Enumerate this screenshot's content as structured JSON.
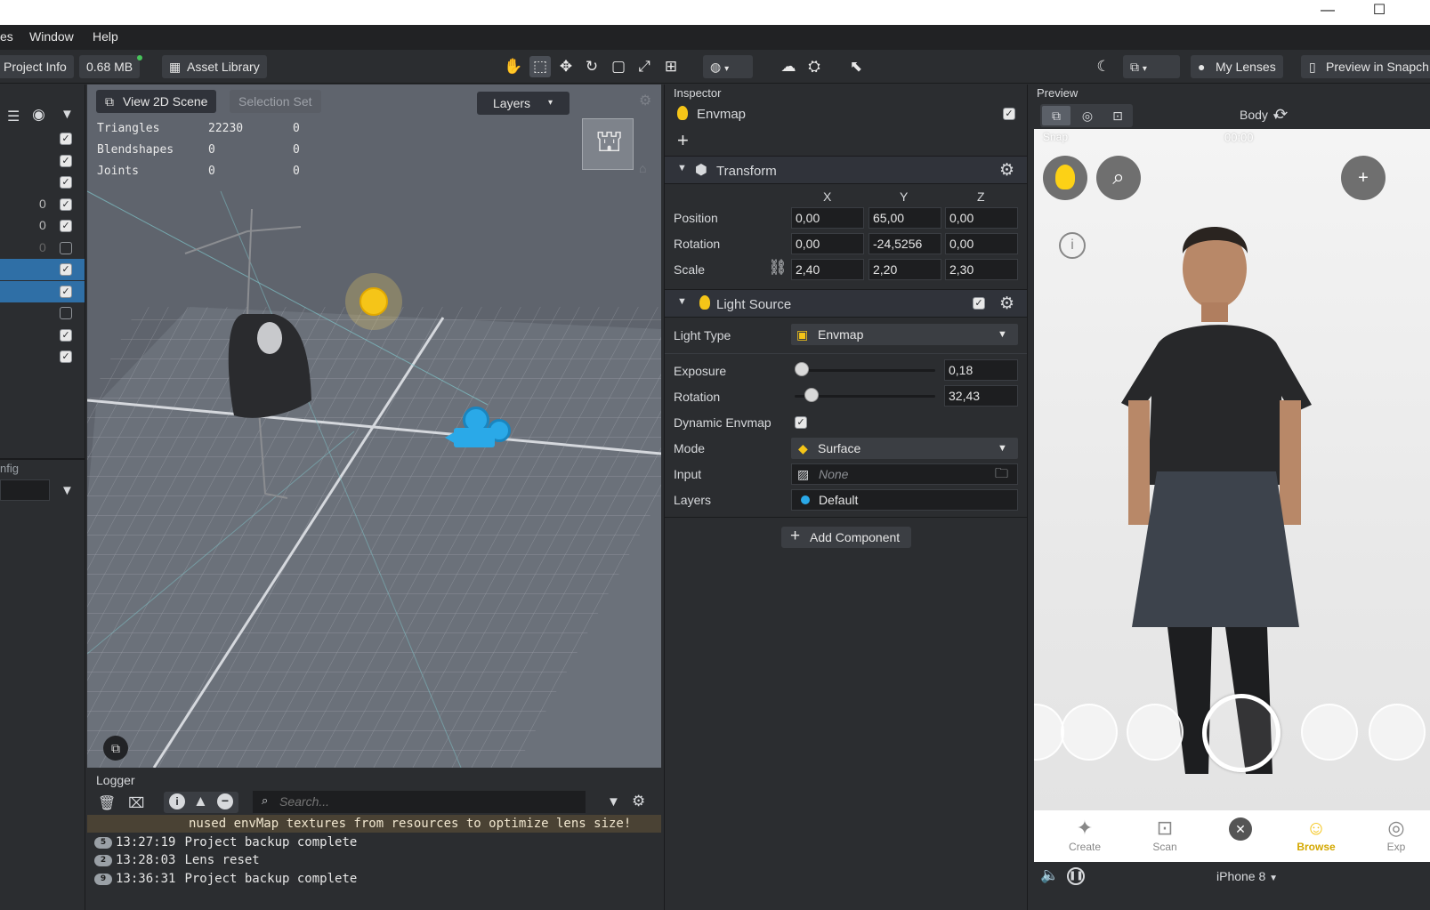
{
  "window": {
    "minimize": "—",
    "maximize": "☐"
  },
  "menu": {
    "items": [
      "es",
      "Window",
      "Help"
    ]
  },
  "toolbar": {
    "project_info": "Project Info",
    "project_size": "0.68 MB",
    "asset_library": "Asset Library",
    "my_lenses": "My Lenses",
    "preview_in_snapchat": "Preview in Snapch"
  },
  "hierarchy": {
    "rows": [
      {
        "num": "",
        "checked": true
      },
      {
        "num": "",
        "checked": true
      },
      {
        "num": "",
        "checked": true
      },
      {
        "num": "0",
        "checked": true
      },
      {
        "num": "0",
        "checked": true
      },
      {
        "num": "0",
        "checked": false
      },
      {
        "num": "",
        "checked": true,
        "selected": true
      },
      {
        "num": "",
        "checked": true,
        "selected": true
      },
      {
        "num": "",
        "checked": false
      },
      {
        "num": "",
        "checked": true
      },
      {
        "num": "",
        "checked": true
      }
    ],
    "config_label": "nfig"
  },
  "viewport": {
    "view_2d_scene": "View 2D Scene",
    "selection_set": "Selection Set",
    "layers": "Layers",
    "stats": [
      {
        "label": "Triangles",
        "v1": "22230",
        "v2": "0"
      },
      {
        "label": "Blendshapes",
        "v1": "0",
        "v2": "0"
      },
      {
        "label": "Joints",
        "v1": "0",
        "v2": "0"
      }
    ]
  },
  "logger": {
    "title": "Logger",
    "search_placeholder": "Search...",
    "lines": [
      {
        "badge": "",
        "time": "",
        "text": "nused envMap textures from resources to optimize lens size!"
      },
      {
        "badge": "5",
        "time": "13:27:19",
        "text": "Project backup complete"
      },
      {
        "badge": "2",
        "time": "13:28:03",
        "text": "Lens reset"
      },
      {
        "badge": "9",
        "time": "13:36:31",
        "text": "Project backup complete"
      }
    ]
  },
  "inspector": {
    "title": "Inspector",
    "object_name": "Envmap",
    "transform": {
      "title": "Transform",
      "axes": [
        "X",
        "Y",
        "Z"
      ],
      "position_label": "Position",
      "rotation_label": "Rotation",
      "scale_label": "Scale",
      "position": [
        "0,00",
        "65,00",
        "0,00"
      ],
      "rotation": [
        "0,00",
        "-24,5256",
        "0,00"
      ],
      "scale": [
        "2,40",
        "2,20",
        "2,30"
      ]
    },
    "light": {
      "title": "Light Source",
      "light_type_label": "Light Type",
      "light_type": "Envmap",
      "exposure_label": "Exposure",
      "exposure": "0,18",
      "rotation_label": "Rotation",
      "rotation": "32,43",
      "dynamic_label": "Dynamic Envmap",
      "mode_label": "Mode",
      "mode": "Surface",
      "input_label": "Input",
      "input": "None",
      "layers_label": "Layers",
      "layers": "Default"
    },
    "add_component": "Add Component"
  },
  "preview": {
    "title": "Preview",
    "tracking": "Body",
    "status_carrier": "Snap",
    "status_time": "00:00",
    "device": "iPhone 8",
    "nav": [
      "Create",
      "Scan",
      "",
      "Browse",
      "Exp"
    ]
  },
  "colors": {
    "accent": "#2f6fa6",
    "yellow": "#f5c518",
    "camera_blue": "#2aa9e8"
  }
}
